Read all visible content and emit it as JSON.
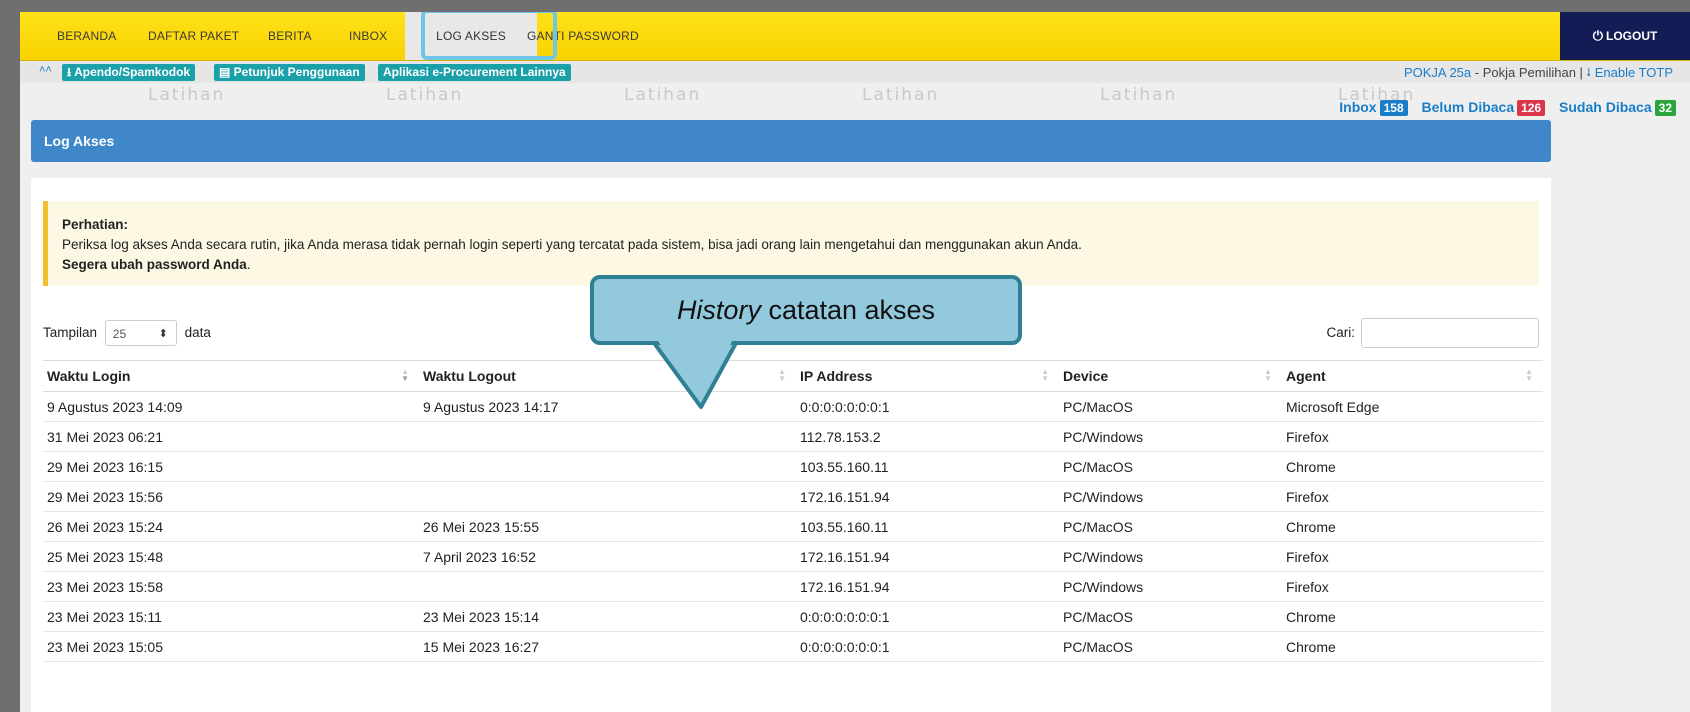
{
  "nav": {
    "items": [
      "BERANDA",
      "DAFTAR PAKET",
      "BERITA",
      "INBOX",
      "LOG AKSES",
      "GANTI PASSWORD"
    ],
    "active": "LOG AKSES",
    "logout": "LOGOUT"
  },
  "toolbar": {
    "buttons": [
      "Apendo/Spamkodok",
      "Petunjuk Penggunaan",
      "Aplikasi e-Procurement Lainnya"
    ]
  },
  "user": {
    "name": "POKJA 25a",
    "role": " - Pokja Pemilihan | ",
    "totp": "Enable TOTP"
  },
  "watermark": "Latihan",
  "counts": {
    "inbox_label": "Inbox",
    "inbox_count": "158",
    "unread_label": "Belum Dibaca",
    "unread_count": "126",
    "read_label": "Sudah Dibaca",
    "read_count": "32"
  },
  "panel": {
    "title": "Log Akses"
  },
  "alert": {
    "title": "Perhatian:",
    "body": "Periksa log akses Anda secara rutin, jika Anda merasa tidak pernah login seperti yang tercatat pada sistem, bisa jadi orang lain mengetahui dan menggunakan akun Anda.",
    "strong": "Segera ubah password Anda",
    "end": "."
  },
  "length": {
    "prefix": "Tampilan",
    "value": "25",
    "suffix": "data"
  },
  "search": {
    "label": "Cari:"
  },
  "table": {
    "headers": [
      "Waktu Login",
      "Waktu Logout",
      "IP Address",
      "Device",
      "Agent"
    ],
    "rows": [
      [
        "9 Agustus 2023 14:09",
        "9 Agustus 2023 14:17",
        "0:0:0:0:0:0:0:1",
        "PC/MacOS",
        "Microsoft Edge"
      ],
      [
        "31 Mei 2023 06:21",
        "",
        "112.78.153.2",
        "PC/Windows",
        "Firefox"
      ],
      [
        "29 Mei 2023 16:15",
        "",
        "103.55.160.11",
        "PC/MacOS",
        "Chrome"
      ],
      [
        "29 Mei 2023 15:56",
        "",
        "172.16.151.94",
        "PC/Windows",
        "Firefox"
      ],
      [
        "26 Mei 2023 15:24",
        "26 Mei 2023 15:55",
        "103.55.160.11",
        "PC/MacOS",
        "Chrome"
      ],
      [
        "25 Mei 2023 15:48",
        "7 April 2023 16:52",
        "172.16.151.94",
        "PC/Windows",
        "Firefox"
      ],
      [
        "23 Mei 2023 15:58",
        "",
        "172.16.151.94",
        "PC/Windows",
        "Firefox"
      ],
      [
        "23 Mei 2023 15:11",
        "23 Mei 2023 15:14",
        "0:0:0:0:0:0:0:1",
        "PC/MacOS",
        "Chrome"
      ],
      [
        "23 Mei 2023 15:05",
        "15 Mei 2023 16:27",
        "0:0:0:0:0:0:0:1",
        "PC/MacOS",
        "Chrome"
      ]
    ]
  },
  "callout": {
    "italic": "History",
    "text": " catatan akses"
  },
  "colors": {
    "nav": "#f8d200",
    "logout": "#131c55",
    "panel": "#3f87c9",
    "teal": "#1aa0a9",
    "callout": "#93c9dd"
  }
}
